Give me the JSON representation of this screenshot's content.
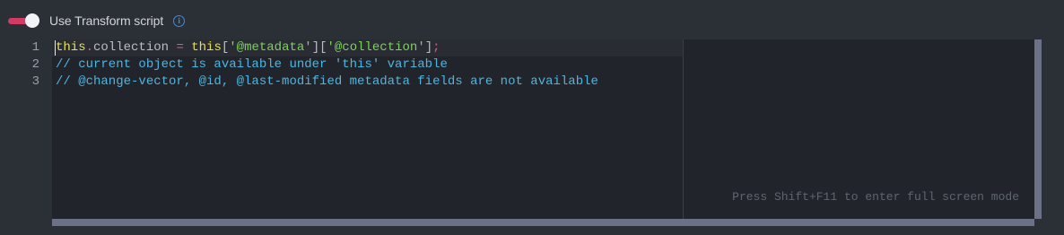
{
  "transform": {
    "toggle_on": true,
    "label": "Use Transform script",
    "info_icon": "info-icon",
    "accent_color": "#d43a63",
    "info_color": "#3d8bf0"
  },
  "editor": {
    "line_numbers": [
      "1",
      "2",
      "3"
    ],
    "lines": [
      {
        "tokens": [
          {
            "text": "this",
            "type": "kw"
          },
          {
            "text": ".",
            "type": "op"
          },
          {
            "text": "collection",
            "type": "prop"
          },
          {
            "text": " ",
            "type": "punct"
          },
          {
            "text": "=",
            "type": "op"
          },
          {
            "text": " ",
            "type": "punct"
          },
          {
            "text": "this",
            "type": "kw"
          },
          {
            "text": "[",
            "type": "punct"
          },
          {
            "text": "'@metadata'",
            "type": "str"
          },
          {
            "text": "][",
            "type": "punct"
          },
          {
            "text": "'@collection'",
            "type": "str"
          },
          {
            "text": "]",
            "type": "punct"
          },
          {
            "text": ";",
            "type": "op"
          }
        ]
      },
      {
        "tokens": [
          {
            "text": "// current object is available under 'this' variable",
            "type": "comment"
          }
        ]
      },
      {
        "tokens": [
          {
            "text": "// @change-vector, @id, @last-modified metadata fields are not available",
            "type": "comment"
          }
        ]
      }
    ],
    "hint": "Press Shift+F11 to enter full screen mode"
  }
}
